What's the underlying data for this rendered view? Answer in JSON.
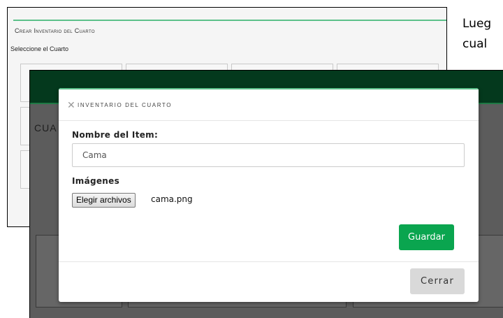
{
  "document": {
    "text_lines": [
      "Lueg",
      "cual"
    ]
  },
  "back_screen": {
    "title": "Crear Inventario del Cuarto",
    "subtitle": "Seleccione el Cuarto"
  },
  "front_screen": {
    "heading_fragment": "CUA"
  },
  "modal": {
    "close_icon": "close-x-icon",
    "title": "INVENTARIO DEL CUARTO",
    "item_name_label": "Nombre del Item:",
    "item_name_value": "Cama",
    "images_label": "Imágenes",
    "file_button_label": "Elegir archivos",
    "file_name": "cama.png",
    "save_label": "Guardar",
    "close_label": "Cerrar"
  },
  "colors": {
    "accent_green": "#0aa54f",
    "header_dark_green": "#04391d",
    "topline_green": "#5cc08a",
    "close_button_gray": "#d9d9d9"
  }
}
